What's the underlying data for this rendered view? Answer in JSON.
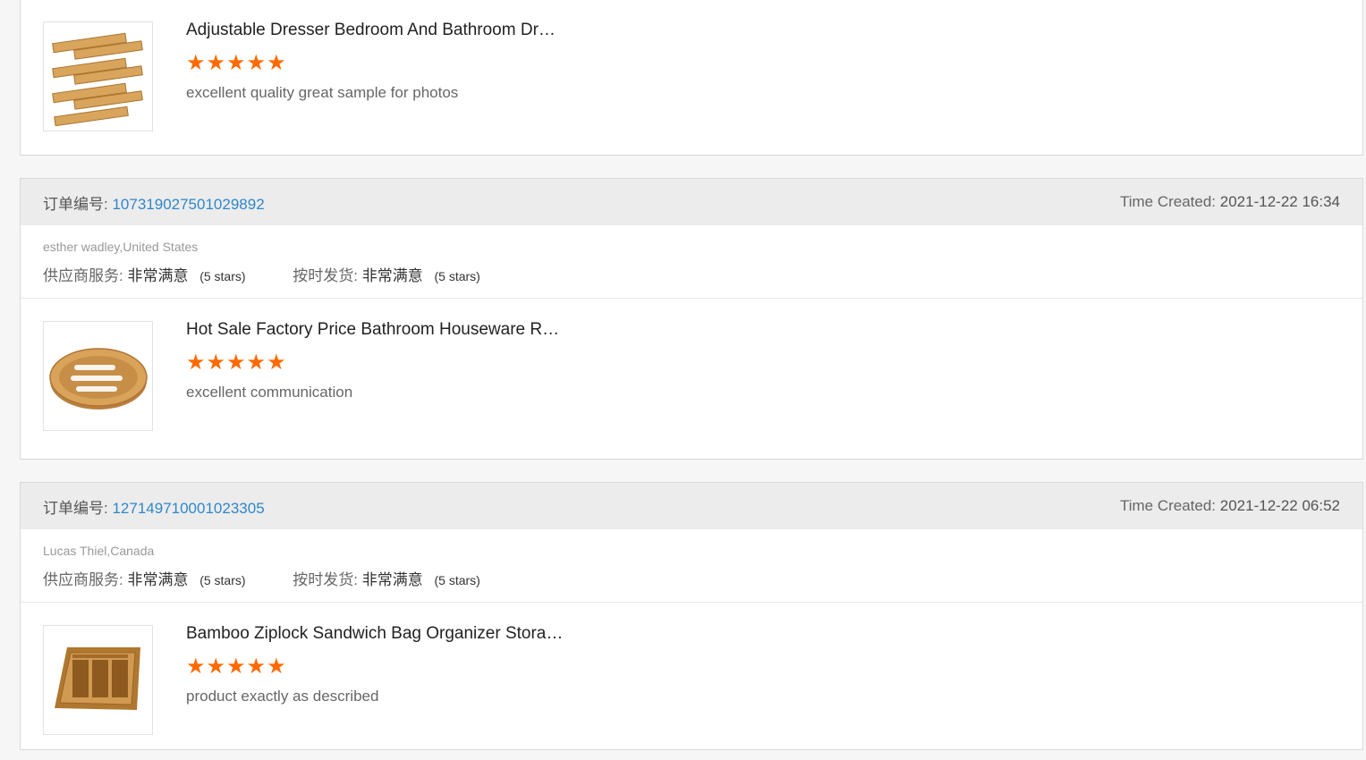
{
  "labels": {
    "order_prefix": "订单编号:",
    "time_prefix": "Time Created:",
    "supplier_service": "供应商服务:",
    "on_time_delivery": "按时发货:"
  },
  "colors": {
    "star": "#ff6a00",
    "link": "#2f87c8",
    "header_bg": "#ececec"
  },
  "cards": [
    {
      "product": {
        "title": "Adjustable Dresser Bedroom And Bathroom Dr…",
        "stars": 5,
        "star_glyph": "★★★★★",
        "comment": "excellent quality great sample for photos",
        "thumb_icon": "bamboo-drawer-dividers-image"
      }
    },
    {
      "order_no": "107319027501029892",
      "time_created": "2021-12-22 16:34",
      "buyer": "esther wadley,United States",
      "supplier_rating": "非常满意",
      "supplier_stars": "(5 stars)",
      "delivery_rating": "非常满意",
      "delivery_stars": "(5 stars)",
      "product": {
        "title": "Hot Sale Factory Price Bathroom Houseware R…",
        "stars": 5,
        "star_glyph": "★★★★★",
        "comment": "excellent communication",
        "thumb_icon": "bamboo-soap-dish-image"
      }
    },
    {
      "order_no": "127149710001023305",
      "time_created": "2021-12-22 06:52",
      "buyer": "Lucas Thiel,Canada",
      "supplier_rating": "非常满意",
      "supplier_stars": "(5 stars)",
      "delivery_rating": "非常满意",
      "delivery_stars": "(5 stars)",
      "product": {
        "title": "Bamboo Ziplock Sandwich Bag Organizer Stora…",
        "stars": 5,
        "star_glyph": "★★★★★",
        "comment": "product exactly as described",
        "thumb_icon": "bamboo-bag-organizer-image"
      }
    }
  ]
}
